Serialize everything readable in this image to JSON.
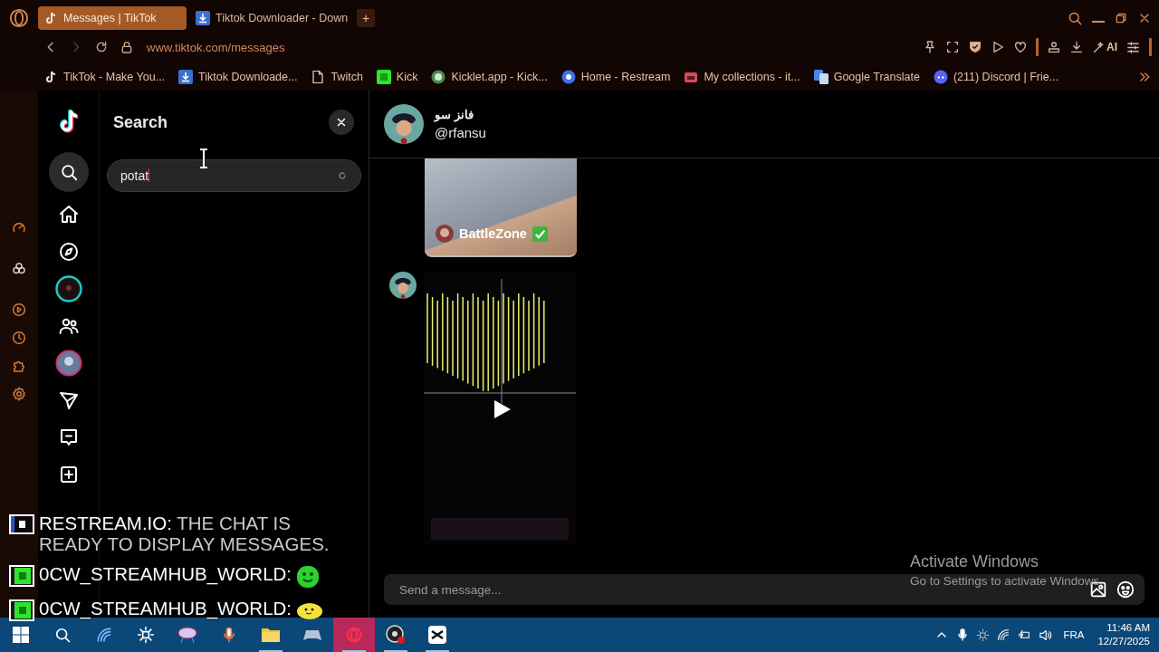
{
  "browser": {
    "tabs": [
      {
        "label": "Messages | TikTok",
        "kind": "tiktok",
        "selected": true
      },
      {
        "label": "Tiktok Downloader - Down",
        "kind": "download",
        "selected": false
      }
    ],
    "new_tab": "+",
    "url": "www.tiktok.com/messages",
    "ai_label": "AI",
    "bookmarks": [
      {
        "label": "TikTok - Make You...",
        "kind": "tiktok"
      },
      {
        "label": "Tiktok Downloade...",
        "kind": "download"
      },
      {
        "label": "Twitch",
        "kind": "page"
      },
      {
        "label": "Kick",
        "kind": "kick"
      },
      {
        "label": "Kicklet.app - Kick...",
        "kind": "kicklet"
      },
      {
        "label": "Home - Restream",
        "kind": "restream"
      },
      {
        "label": "My collections - it...",
        "kind": "collection"
      },
      {
        "label": "Google Translate",
        "kind": "translate"
      },
      {
        "label": "(211) Discord | Frie...",
        "kind": "discord"
      }
    ]
  },
  "browser_sidebar": {
    "items": [
      {
        "kind": "gauge"
      },
      {
        "kind": "knot"
      },
      {
        "kind": "play"
      },
      {
        "kind": "clock"
      },
      {
        "kind": "puzzle"
      },
      {
        "kind": "gear"
      }
    ]
  },
  "tiktok_nav": {
    "items": [
      {
        "kind": "search",
        "selected": true
      },
      {
        "kind": "home",
        "selected": false
      },
      {
        "kind": "explore",
        "selected": false
      },
      {
        "kind": "avatar-ring",
        "selected": false
      },
      {
        "kind": "friends",
        "selected": false
      },
      {
        "kind": "avatar",
        "selected": false
      },
      {
        "kind": "send",
        "selected": false
      },
      {
        "kind": "inbox",
        "selected": false
      },
      {
        "kind": "upload",
        "selected": false
      }
    ]
  },
  "search_panel": {
    "title": "Search",
    "query": "potat"
  },
  "conversation": {
    "name": "فانز سو",
    "handle": "@rfansu",
    "messages": [
      {
        "kind": "video_card",
        "caption": "BattleZone",
        "verified": true
      },
      {
        "kind": "video"
      }
    ],
    "input": {
      "placeholder": "Send a message..."
    }
  },
  "stream_chat": [
    {
      "kind": "restream",
      "author": "RESTREAM.IO:",
      "text": "THE CHAT IS READY TO DISPLAY MESSAGES.",
      "emote": false
    },
    {
      "kind": "kick",
      "author": "0CW_STREAMHUB_WORLD:",
      "emote": true
    },
    {
      "kind": "kick",
      "author": "0CW_STREAMHUB_WORLD:",
      "emote": true
    }
  ],
  "activation_notice": {
    "title": "Activate Windows",
    "subtitle": "Go to Settings to activate Windows."
  },
  "taskbar": {
    "apps": [
      {
        "kind": "start",
        "running": false,
        "selected": false
      },
      {
        "kind": "search",
        "running": false,
        "selected": false
      },
      {
        "kind": "broadcast",
        "running": false,
        "selected": false
      },
      {
        "kind": "capture",
        "running": false,
        "selected": false
      },
      {
        "kind": "satellite",
        "running": false,
        "selected": false
      },
      {
        "kind": "mic",
        "running": false,
        "selected": false
      },
      {
        "kind": "folder",
        "running": true,
        "selected": false
      },
      {
        "kind": "gamepad",
        "running": false,
        "selected": false
      },
      {
        "kind": "browser",
        "running": true,
        "selected": true
      },
      {
        "kind": "obs",
        "running": true,
        "selected": false
      },
      {
        "kind": "capcut",
        "running": true,
        "selected": false
      }
    ],
    "language": "FRA",
    "time": "11:46 AM",
    "date": "12/27/2025"
  }
}
